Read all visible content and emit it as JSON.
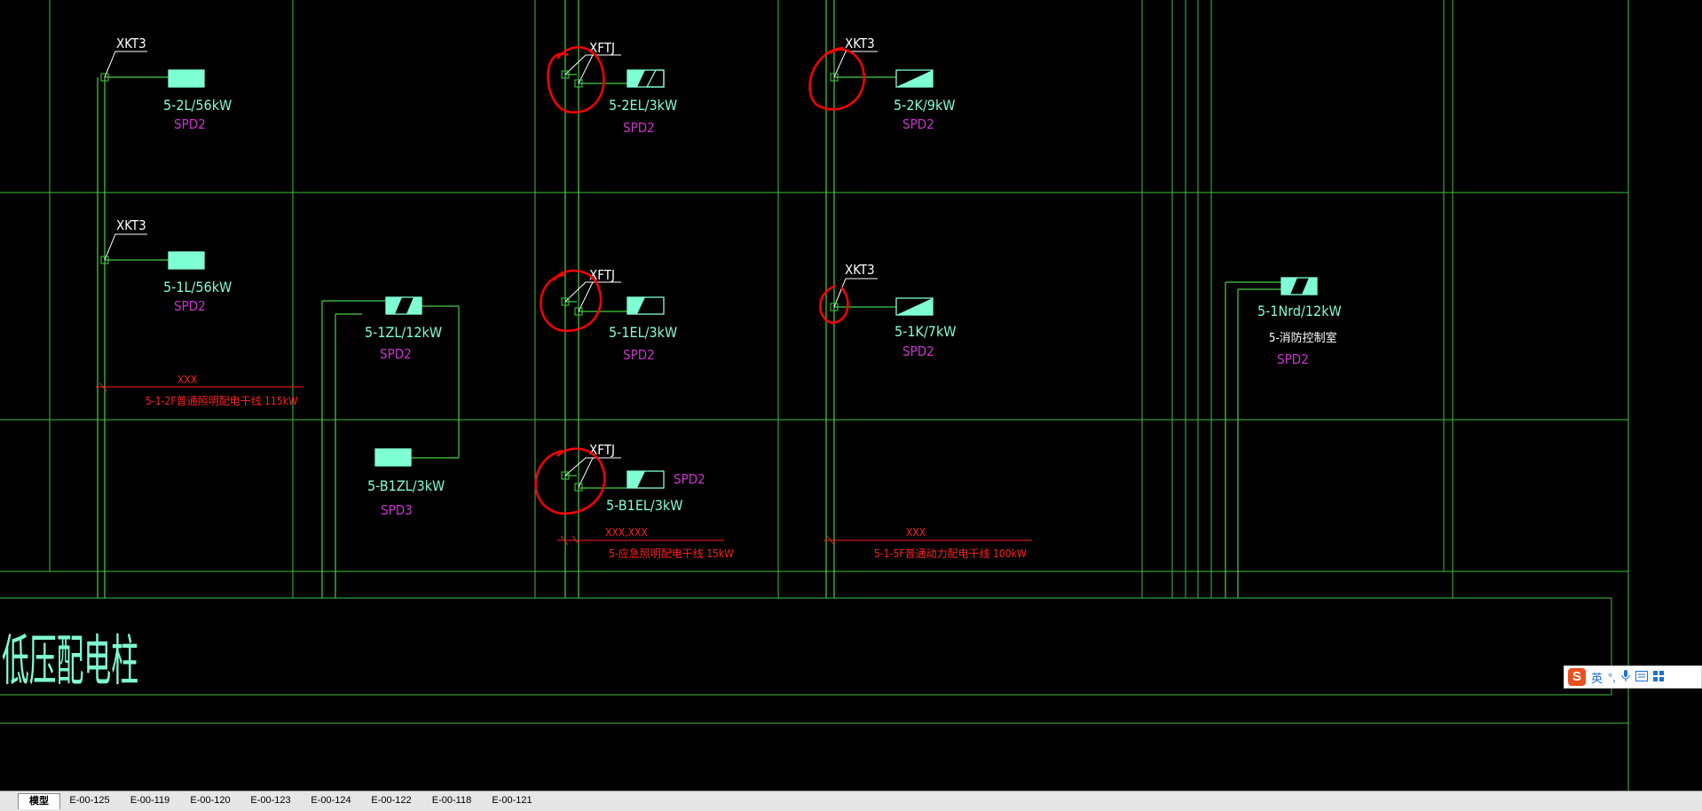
{
  "drawing": {
    "cabinet_label": "低压配电柱",
    "top_row": {
      "xkt3_a_tag": "XKT3",
      "circuit_2l": "5-2L/56kW",
      "spd_2l": "SPD2",
      "xftj_a_tag": "XFTJ",
      "circuit_2el": "5-2EL/3kW",
      "spd_2el": "SPD2",
      "xkt3_b_tag": "XKT3",
      "circuit_2k": "5-2K/9kW",
      "spd_2k": "SPD2"
    },
    "middle_row": {
      "xkt3_c_tag": "XKT3",
      "circuit_1l": "5-1L/56kW",
      "spd_1l": "SPD2",
      "circuit_1zl": "5-1ZL/12kW",
      "spd_1zl": "SPD2",
      "xftj_b_tag": "XFTJ",
      "circuit_1el": "5-1EL/3kW",
      "spd_1el": "SPD2",
      "xkt3_d_tag": "XKT3",
      "circuit_1k": "5-1K/7kW",
      "spd_1k": "SPD2",
      "circuit_1nrd": "5-1Nrd/12kW",
      "desc_1nrd": "5-消防控制室",
      "spd_1nrd": "SPD2",
      "trunk_left_tag": "XXX",
      "trunk_left_desc": "5-1-2F普通照明配电干线 115kW"
    },
    "bottom_row": {
      "circuit_b1zl": "5-B1ZL/3kW",
      "spd_b1zl": "SPD3",
      "xftj_c_tag": "XFTJ",
      "spd_b1el": "SPD2",
      "circuit_b1el": "5-B1EL/3kW",
      "trunk_mid_tag": "XXX,XXX",
      "trunk_mid_desc": "5-应急照明配电干线 15kW",
      "trunk_right_tag": "XXX",
      "trunk_right_desc": "5-1-5F普通动力配电干线 100kW"
    },
    "colors": {
      "background": "#000000",
      "grid_lines": "#3fbf3f",
      "cable_lines": "#44d044",
      "equipment_fill": "#7fffd4",
      "circuit_text": "#7fffd4",
      "spd_text": "#cc33cc",
      "tag_text": "#ffffff",
      "trunk_text": "#ff2020",
      "markup_circles": "#ff0000"
    }
  },
  "tabs": {
    "model": "模型",
    "layouts": [
      "E-00-125",
      "E-00-119",
      "E-00-120",
      "E-00-123",
      "E-00-124",
      "E-00-122",
      "E-00-118",
      "E-00-121"
    ]
  },
  "ime": {
    "logo": "S",
    "mode": "英",
    "punct": "°,",
    "mic_icon": "microphone-icon",
    "keyboard_icon": "keyboard-icon",
    "menu_icon": "grid-menu-icon"
  }
}
